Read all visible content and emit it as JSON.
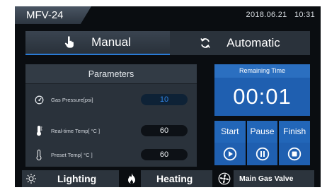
{
  "header": {
    "device_name": "MFV-24",
    "date": "2018.06.21",
    "time": "10:31"
  },
  "mode_tabs": {
    "manual": {
      "label": "Manual",
      "icon": "hand-pointer-icon",
      "active": true
    },
    "automatic": {
      "label": "Automatic",
      "icon": "cycle-arrows-icon",
      "active": false
    }
  },
  "parameters": {
    "title": "Parameters",
    "rows": [
      {
        "label": "Gas Pressure[psi]",
        "value": "10",
        "icon": "gauge-icon"
      },
      {
        "label": "Real-time Temp[ °C ]",
        "value": "60",
        "icon": "thermometer-filled-icon"
      },
      {
        "label": "Preset Temp[ °C ]",
        "value": "60",
        "icon": "thermometer-outline-icon"
      }
    ]
  },
  "remaining": {
    "title": "Remaining Time",
    "value": "00:01"
  },
  "controls": {
    "start": {
      "label": "Start",
      "icon": "play-icon"
    },
    "pause": {
      "label": "Pause",
      "icon": "pause-icon"
    },
    "finish": {
      "label": "Finish",
      "icon": "stop-icon"
    }
  },
  "bottom": {
    "lighting": {
      "label": "Lighting",
      "icon": "sun-icon"
    },
    "heating": {
      "label": "Heating",
      "icon": "flame-icon"
    },
    "gas_valve": {
      "label": "Main Gas Valve",
      "icon": "fan-valve-icon"
    }
  },
  "colors": {
    "background": "#0a0d11",
    "panel": "#2a323b",
    "accent_blue": "#1f5fb0",
    "value_blue": "#2f84e6"
  }
}
